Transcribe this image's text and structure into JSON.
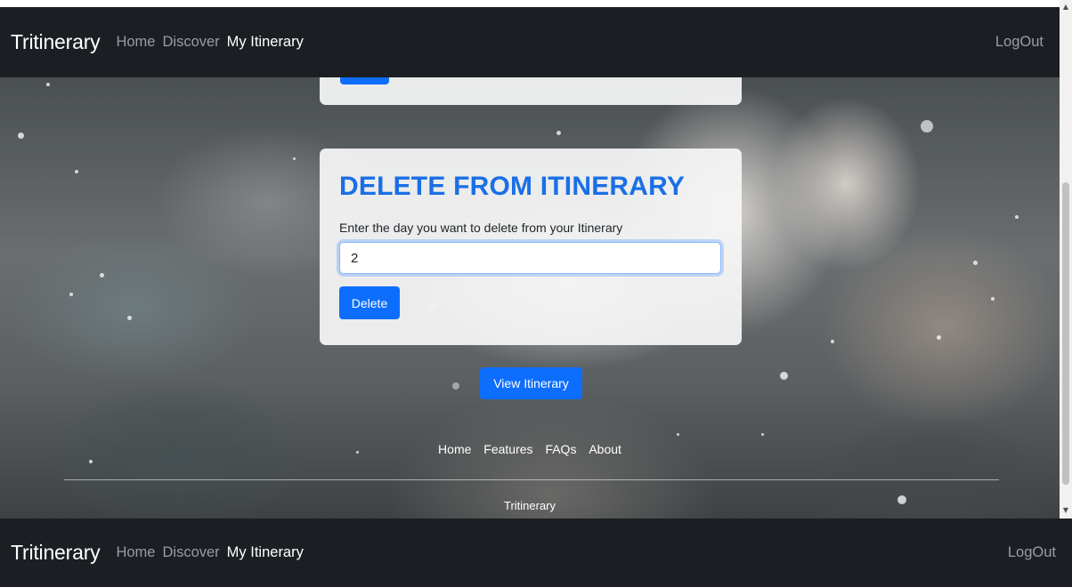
{
  "navbar": {
    "brand": "Tritinerary",
    "links": [
      "Home",
      "Discover",
      "My Itinerary"
    ],
    "logout": "LogOut"
  },
  "delete_card": {
    "title": "DELETE FROM ITINERARY",
    "label": "Enter the day you want to delete from your Itinerary",
    "input_value": "2",
    "button": "Delete"
  },
  "view_button": "View Itinerary",
  "footer": {
    "links": [
      "Home",
      "Features",
      "FAQs",
      "About"
    ],
    "brand": "Tritinerary"
  },
  "colors": {
    "primary": "#0d6efd",
    "title_blue": "#1a6fe6",
    "navbar": "#1b1e22"
  }
}
